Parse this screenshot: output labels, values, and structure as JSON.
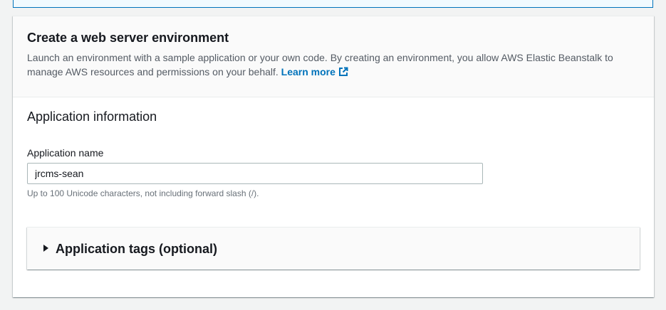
{
  "card": {
    "title": "Create a web server environment",
    "description": "Launch an environment with a sample application or your own code. By creating an environment, you allow AWS Elastic Beanstalk to manage AWS resources and permissions on your behalf. ",
    "learn_more_label": "Learn more",
    "learn_more_icon": "external-link-icon"
  },
  "application_information": {
    "section_title": "Application information",
    "name_label": "Application name",
    "name_value": "jrcms-sean",
    "name_constraint": "Up to 100 Unicode characters, not including forward slash (/)."
  },
  "tags": {
    "expand_icon": "caret-right-icon",
    "title": "Application tags (optional)"
  },
  "colors": {
    "link": "#0073bb",
    "text": "#16191f",
    "secondary_text": "#545b64",
    "page_background": "#f2f3f3"
  }
}
